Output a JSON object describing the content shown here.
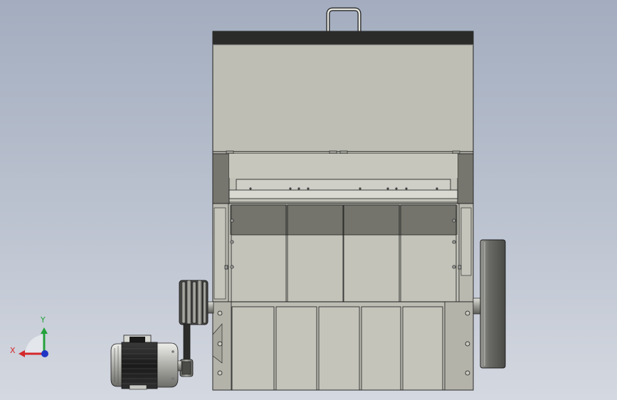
{
  "viewport": {
    "background_top": "#a3adbf",
    "background_bottom": "#d4d8e0"
  },
  "triad": {
    "x_label": "X",
    "y_label": "Y",
    "x_color": "#d4282b",
    "y_color": "#23a23a",
    "z_color": "#2136c4"
  },
  "colors": {
    "hopper_fill": "#bebeb5",
    "hopper_band": "#2b2b29",
    "body_fill": "#c3c3ba",
    "dark_panel": "#74746c",
    "frame_fill": "#b5b5ac",
    "flywheel": "#5d5d5a",
    "motor_body": "#1d1d1d",
    "line": "#1c1c1c"
  }
}
